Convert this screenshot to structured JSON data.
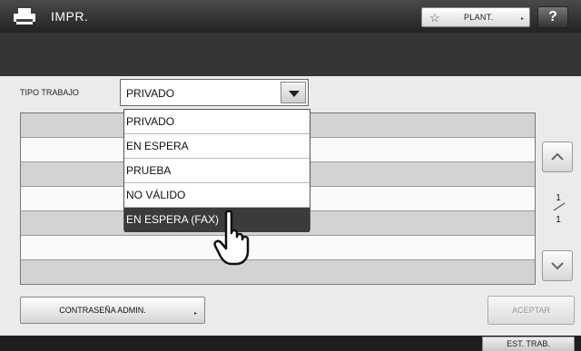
{
  "header": {
    "title": "IMPR.",
    "app_icon": "printer-icon",
    "template_button": {
      "label": "PLANT.",
      "icon": "star-icon",
      "arrow": "▸"
    },
    "help_button": {
      "label": "?"
    }
  },
  "filter": {
    "label": "TIPO TRABAJO",
    "selected": "PRIVADO",
    "options": [
      "PRIVADO",
      "EN ESPERA",
      "PRUEBA",
      "NO VÁLIDO",
      "EN ESPERA (FAX)"
    ],
    "highlighted_index": 4
  },
  "pagination": {
    "current": "1",
    "total": "1",
    "up_icon": "chevron-up-icon",
    "down_icon": "chevron-down-icon"
  },
  "footer": {
    "admin_password_button": "CONTRASEÑA ADMIN.",
    "admin_arrow": "▸",
    "accept_button": "ACEPTAR",
    "job_status_button": "EST. TRAB."
  },
  "pointer": "hand-pointer-icon",
  "colors": {
    "titlebar": "#2c2c2c",
    "band": "#353535",
    "row_grey": "#d3d3d3",
    "row_white": "#fafafa",
    "selected_option": "#3b3b3b",
    "disabled_text": "#9a9a9a"
  }
}
